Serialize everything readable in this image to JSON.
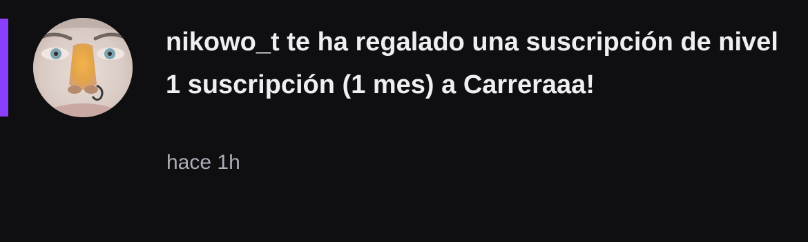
{
  "notification": {
    "message": "nikowo_t te ha regalado una suscripción de nivel 1 suscripción (1 mes) a Carreraaa!",
    "timestamp": "hace 1h",
    "avatar_icon": "user-avatar-photo",
    "unread": true
  },
  "colors": {
    "background": "#0f0e11",
    "accent": "#8a3ffc",
    "text_primary": "#efeff1",
    "text_secondary": "#adadb8"
  }
}
